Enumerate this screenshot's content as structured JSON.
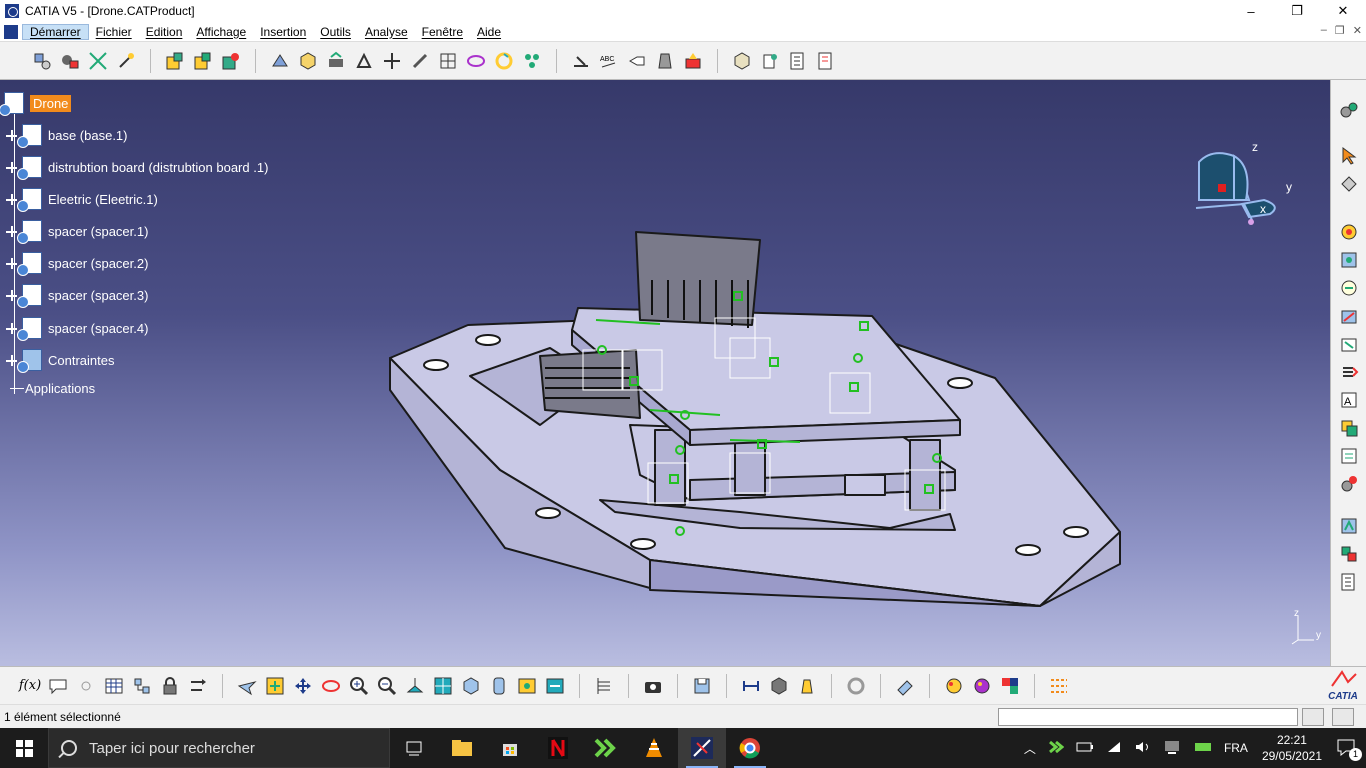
{
  "window": {
    "title": "CATIA V5 - [Drone.CATProduct]",
    "minimize": "–",
    "maximize": "❐",
    "close": "✕"
  },
  "menu": [
    "Démarrer",
    "Fichier",
    "Edition",
    "Affichage",
    "Insertion",
    "Outils",
    "Analyse",
    "Fenêtre",
    "Aide"
  ],
  "tree": {
    "root": "Drone",
    "items": [
      "base (base.1)",
      "distrubtion board  (distrubtion board .1)",
      "Eleetric (Eleetric.1)",
      "spacer (spacer.1)",
      "spacer (spacer.2)",
      "spacer (spacer.3)",
      "spacer (spacer.4)"
    ],
    "constraints": "Contraintes",
    "applications": "Applications"
  },
  "compass": {
    "x": "x",
    "y": "y",
    "z": "z"
  },
  "mini_axis": {
    "y": "y",
    "z": "z"
  },
  "bottom_toolbar": {
    "formula": "f(x)",
    "logo": "CATIA"
  },
  "status": {
    "text": "1 élément sélectionné"
  },
  "taskbar": {
    "search_placeholder": "Taper ici pour rechercher",
    "lang": "FRA",
    "time": "22:21",
    "date": "29/05/2021",
    "notifications": "1"
  },
  "colors": {
    "viewport_top": "#36396a",
    "viewport_bottom": "#b9bde0",
    "part": "#c9c9e6",
    "highlight": "#f28b1c",
    "constraint": "#22c022"
  }
}
